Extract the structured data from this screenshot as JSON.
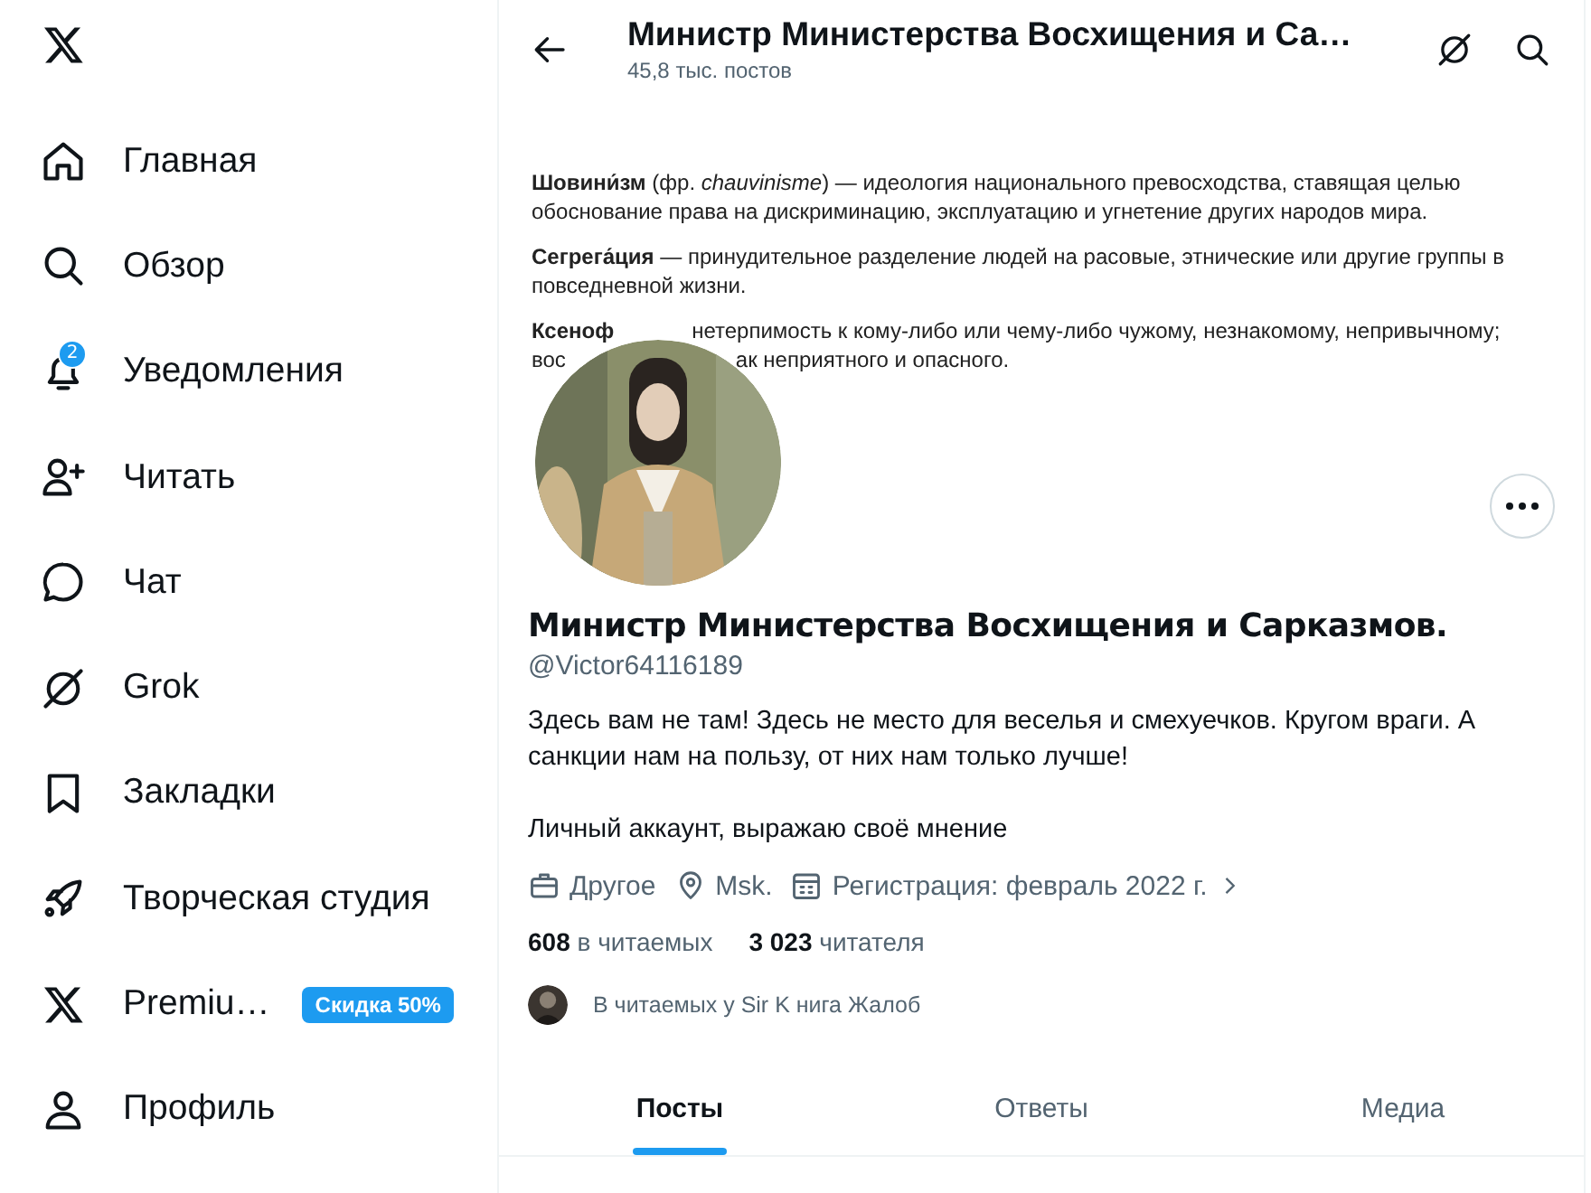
{
  "sidebar": {
    "items": [
      {
        "label": "Главная",
        "selected": false
      },
      {
        "label": "Обзор",
        "selected": false
      },
      {
        "label": "Уведомления",
        "selected": false,
        "badge": "2"
      },
      {
        "label": "Читать",
        "selected": false
      },
      {
        "label": "Чат",
        "selected": false
      },
      {
        "label": "Grok",
        "selected": false
      },
      {
        "label": "Закладки",
        "selected": false
      },
      {
        "label": "Творческая студия",
        "selected": false
      },
      {
        "label": "Premiu…",
        "selected": false,
        "tag": "Скидка 50%"
      },
      {
        "label": "Профиль",
        "selected": false
      }
    ]
  },
  "header": {
    "title": "Министр Министерства Восхищения и Са…",
    "subtitle": "45,8 тыс. постов"
  },
  "banner": {
    "paragraphs": [
      "**Шовини́зм** (фр. *chauvinisme*) — идеология национального превосходства, ставящая целью обоснование права на дискриминацию, эксплуатацию и угнетение других народов мира.",
      "**Сегрега́ция** — принудительное разделение людей на расовые, этнические или другие группы в повседневной жизни."
    ],
    "covered_lines": [
      {
        "left": "Ксеноф",
        "right": "нетерпимость к кому-либо или чему-либо чужому, незнакомому, непривычному;"
      },
      {
        "left": "вос",
        "right": "ак неприятного и опасного."
      }
    ]
  },
  "profile": {
    "name": "Министр Министерства Восхищения и Сарказмов.",
    "handle": "@Victor64116189",
    "bio": [
      "Здесь вам не там! Здесь не место для веселья и смехуечков. Кругом враги. А санкции нам на пользу, от них нам только лучше!",
      "Личный аккаунт, выражаю своё мнение"
    ],
    "meta": [
      {
        "kind": "category",
        "text": "Другое"
      },
      {
        "kind": "location",
        "text": "Msk."
      },
      {
        "kind": "joined",
        "text": "Регистрация: февраль 2022 г."
      }
    ],
    "stats": [
      {
        "count": "608",
        "label": "в читаемых"
      },
      {
        "count": "3 023",
        "label": "читателя"
      }
    ],
    "followed_by": "В читаемых у Sir K нига Жалоб"
  },
  "tabs": [
    {
      "label": "Посты",
      "selected": true
    },
    {
      "label": "Ответы",
      "selected": false
    },
    {
      "label": "Медиа",
      "selected": false
    }
  ]
}
